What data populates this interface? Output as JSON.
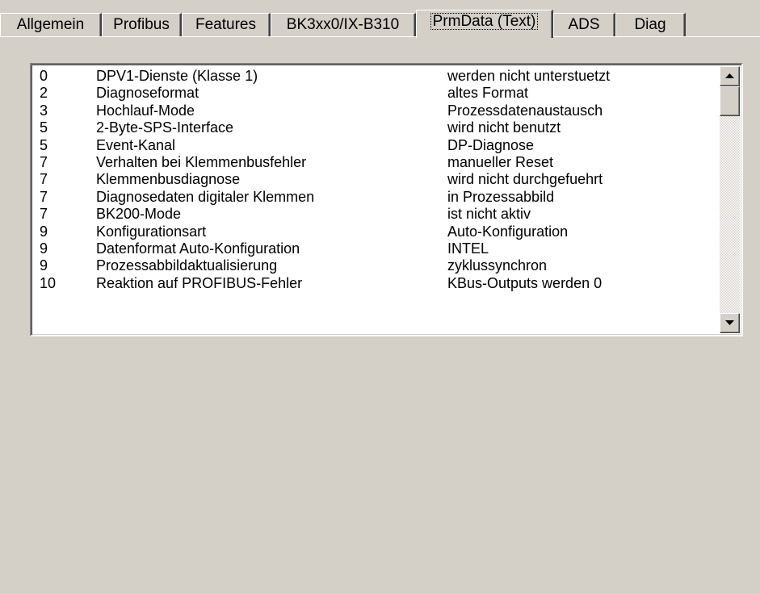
{
  "tabs": [
    {
      "label": "Allgemein"
    },
    {
      "label": "Profibus"
    },
    {
      "label": "Features"
    },
    {
      "label": "BK3xx0/IX-B310"
    },
    {
      "label": "PrmData (Text)"
    },
    {
      "label": "ADS"
    },
    {
      "label": "Diag"
    }
  ],
  "active_tab": "PrmData (Text)",
  "list": {
    "rows": [
      {
        "num": "0",
        "name": "DPV1-Dienste (Klasse 1)",
        "value": "werden nicht unterstuetzt"
      },
      {
        "num": "2",
        "name": "Diagnoseformat",
        "value": "altes Format"
      },
      {
        "num": "3",
        "name": "Hochlauf-Mode",
        "value": "Prozessdatenaustausch"
      },
      {
        "num": "5",
        "name": "2-Byte-SPS-Interface",
        "value": "wird nicht benutzt"
      },
      {
        "num": "5",
        "name": "Event-Kanal",
        "value": "DP-Diagnose"
      },
      {
        "num": "7",
        "name": "Verhalten bei Klemmenbusfehler",
        "value": "manueller Reset"
      },
      {
        "num": "7",
        "name": "Klemmenbusdiagnose",
        "value": "wird nicht durchgefuehrt"
      },
      {
        "num": "7",
        "name": "Diagnosedaten digitaler Klemmen",
        "value": "in Prozessabbild"
      },
      {
        "num": "7",
        "name": "BK200-Mode",
        "value": "ist nicht aktiv"
      },
      {
        "num": "9",
        "name": "Konfigurationsart",
        "value": "Auto-Konfiguration"
      },
      {
        "num": "9",
        "name": "Datenformat Auto-Konfiguration",
        "value": "INTEL"
      },
      {
        "num": "9",
        "name": "Prozessabbildaktualisierung",
        "value": "zyklussynchron"
      },
      {
        "num": "10",
        "name": "Reaktion auf PROFIBUS-Fehler",
        "value": "KBus-Outputs werden 0"
      }
    ]
  },
  "icons": {
    "scroll_up": "arrow-up-icon",
    "scroll_down": "arrow-down-icon"
  },
  "colors": {
    "dialog_bg": "#d4d0c8",
    "list_bg": "#ffffff",
    "text": "#000000"
  }
}
